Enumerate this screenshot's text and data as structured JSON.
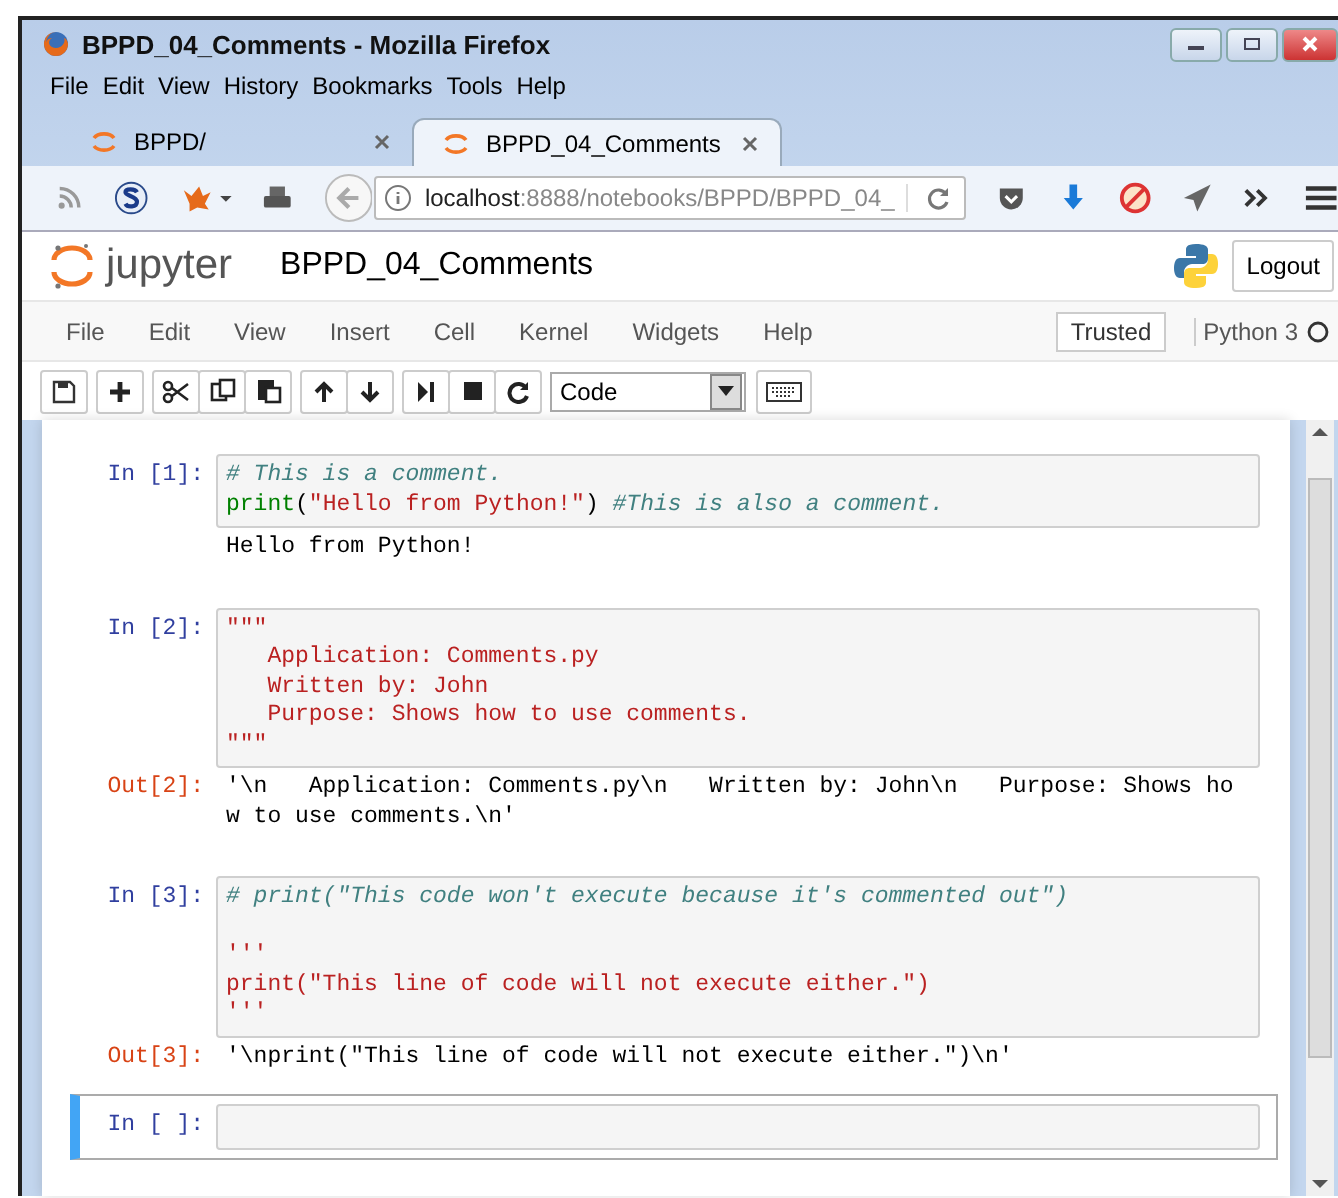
{
  "window": {
    "title": "BPPD_04_Comments - Mozilla Firefox"
  },
  "browser_menu": [
    "File",
    "Edit",
    "View",
    "History",
    "Bookmarks",
    "Tools",
    "Help"
  ],
  "tabs": [
    {
      "label": "BPPD/",
      "selected": false
    },
    {
      "label": "BPPD_04_Comments",
      "selected": true
    }
  ],
  "address_bar": {
    "host": "localhost",
    "path": ":8888/notebooks/BPPD/BPPD_04_"
  },
  "jupyter": {
    "logo_text": "jupyter",
    "notebook_name": "BPPD_04_Comments",
    "logout": "Logout",
    "menu": [
      "File",
      "Edit",
      "View",
      "Insert",
      "Cell",
      "Kernel",
      "Widgets",
      "Help"
    ],
    "trusted": "Trusted",
    "kernel": "Python 3",
    "cell_type": "Code"
  },
  "cells": [
    {
      "prompt": "In [1]:",
      "selected": false,
      "lines": [
        {
          "kind": "code",
          "segments": [
            {
              "kind": "comment",
              "text": "# This is a comment."
            }
          ]
        },
        {
          "kind": "code",
          "segments": [
            {
              "kind": "builtin",
              "text": "print"
            },
            {
              "kind": "plain",
              "text": "("
            },
            {
              "kind": "string",
              "text": "\"Hello from Python!\""
            },
            {
              "kind": "plain",
              "text": ") "
            },
            {
              "kind": "comment",
              "text": "#This is also a comment."
            }
          ]
        }
      ],
      "output": {
        "kind": "stream",
        "lines": [
          "Hello from Python!"
        ]
      }
    },
    {
      "prompt": "In [2]:",
      "selected": false,
      "lines": [
        {
          "kind": "code",
          "segments": [
            {
              "kind": "string",
              "text": "\"\"\""
            }
          ]
        },
        {
          "kind": "code",
          "segments": [
            {
              "kind": "string",
              "text": "   Application: Comments.py"
            }
          ]
        },
        {
          "kind": "code",
          "segments": [
            {
              "kind": "string",
              "text": "   Written by: John"
            }
          ]
        },
        {
          "kind": "code",
          "segments": [
            {
              "kind": "string",
              "text": "   Purpose: Shows how to use comments."
            }
          ]
        },
        {
          "kind": "code",
          "segments": [
            {
              "kind": "string",
              "text": "\"\"\""
            }
          ]
        }
      ],
      "output": {
        "kind": "result",
        "prompt": "Out[2]:",
        "lines": [
          "'\\n   Application: Comments.py\\n   Written by: John\\n   Purpose: Shows ho",
          "w to use comments.\\n'"
        ]
      }
    },
    {
      "prompt": "In [3]:",
      "selected": false,
      "lines": [
        {
          "kind": "code",
          "segments": [
            {
              "kind": "comment",
              "text": "# print(\"This code won't execute because it's commented out\")"
            }
          ]
        },
        {
          "kind": "blank"
        },
        {
          "kind": "code",
          "segments": [
            {
              "kind": "string",
              "text": "'''"
            }
          ]
        },
        {
          "kind": "code",
          "segments": [
            {
              "kind": "string",
              "text": "print(\"This line of code will not execute either.\")"
            }
          ]
        },
        {
          "kind": "code",
          "segments": [
            {
              "kind": "string",
              "text": "'''"
            }
          ]
        }
      ],
      "output": {
        "kind": "result",
        "prompt": "Out[3]:",
        "lines": [
          "'\\nprint(\"This line of code will not execute either.\")\\n'"
        ]
      }
    },
    {
      "prompt": "In [ ]:",
      "selected": true,
      "lines": [
        {
          "kind": "blank"
        }
      ]
    }
  ]
}
